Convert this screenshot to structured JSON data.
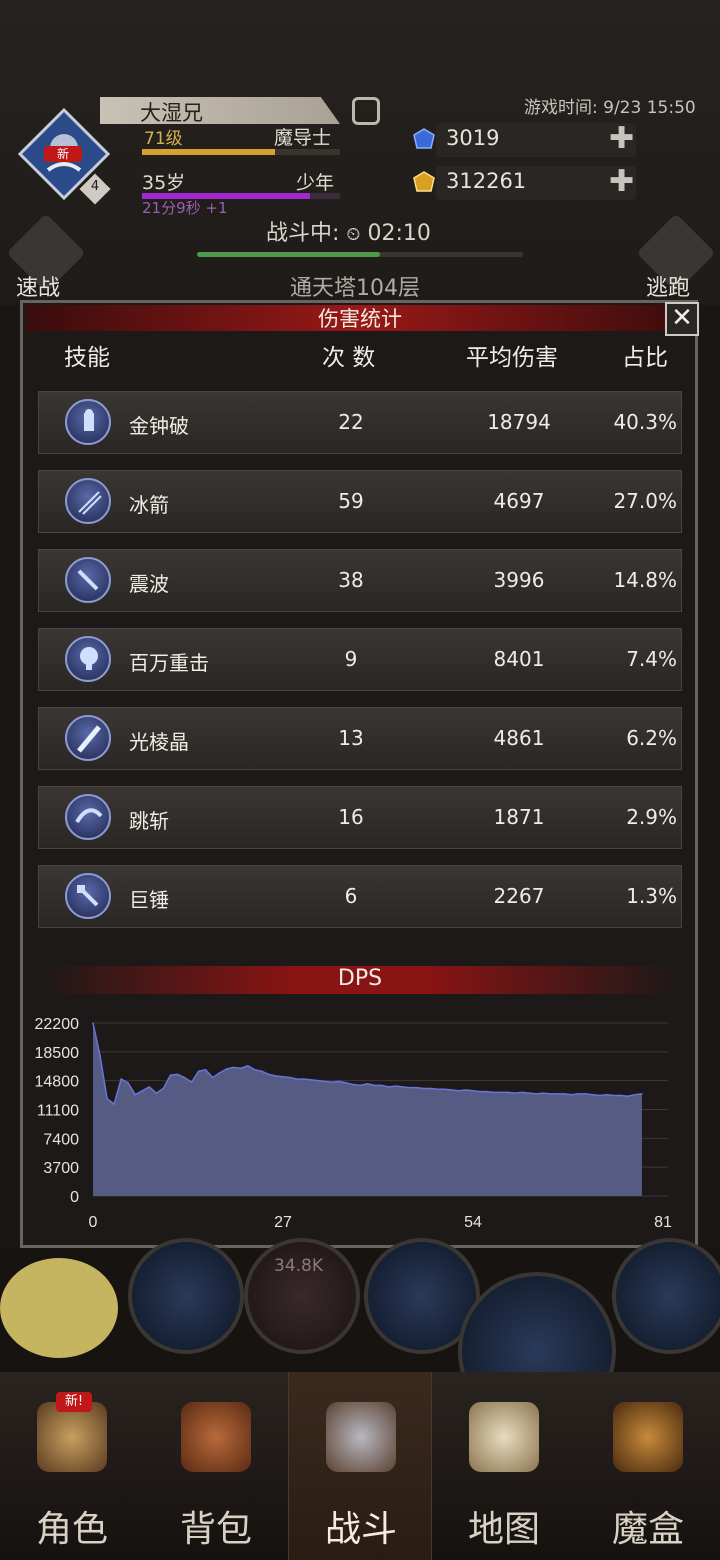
{
  "header": {
    "player_name": "大湿兄",
    "level": "71级",
    "class": "魔导士",
    "level_progress": 0.67,
    "age": "35岁",
    "age_stage": "少年",
    "age_progress": 0.85,
    "age_timer": "21分9秒 +1",
    "game_time": "游戏时间: 9/23 15:50",
    "emblem_badge": "新",
    "emblem_number": "4",
    "crystals": "3019",
    "gold": "312261",
    "battle_status": "战斗中:",
    "battle_time": "02:10",
    "battle_progress": 0.56,
    "tower_floor": "通天塔104层",
    "quick_battle_label": "速战",
    "escape_label": "逃跑"
  },
  "dialog": {
    "title": "伤害统计",
    "close_label": "✕",
    "columns": [
      "技能",
      "次 数",
      "平均伤害",
      "占比"
    ],
    "rows": [
      {
        "skill": "金钟破",
        "count": "22",
        "avg": "18794",
        "pct": "40.3%",
        "icon": "guardian-icon"
      },
      {
        "skill": "冰箭",
        "count": "59",
        "avg": "4697",
        "pct": "27.0%",
        "icon": "ice-arrow-icon"
      },
      {
        "skill": "震波",
        "count": "38",
        "avg": "3996",
        "pct": "14.8%",
        "icon": "sword-icon"
      },
      {
        "skill": "百万重击",
        "count": "9",
        "avg": "8401",
        "pct": "7.4%",
        "icon": "explosion-icon"
      },
      {
        "skill": "光棱晶",
        "count": "13",
        "avg": "4861",
        "pct": "6.2%",
        "icon": "light-blade-icon"
      },
      {
        "skill": "跳斩",
        "count": "16",
        "avg": "1871",
        "pct": "2.9%",
        "icon": "slash-icon"
      },
      {
        "skill": "巨锤",
        "count": "6",
        "avg": "2267",
        "pct": "1.3%",
        "icon": "hammer-icon"
      }
    ],
    "dps_title": "DPS"
  },
  "chart_data": {
    "type": "area",
    "title": "DPS",
    "xlabel": "",
    "ylabel": "",
    "xlim": [
      0,
      81
    ],
    "ylim": [
      0,
      22200
    ],
    "x_ticks": [
      "0",
      "27",
      "54",
      "81"
    ],
    "y_ticks": [
      "22200",
      "18500",
      "14800",
      "11100",
      "7400",
      "3700",
      "0"
    ],
    "grid": true,
    "color": "#5a5f8a",
    "line_color": "#6a74d8",
    "x": [
      0,
      1,
      2,
      3,
      4,
      5,
      6,
      7,
      8,
      9,
      10,
      11,
      12,
      13,
      14,
      15,
      16,
      17,
      18,
      19,
      20,
      21,
      22,
      23,
      24,
      25,
      26,
      27,
      28,
      29,
      30,
      31,
      32,
      33,
      34,
      35,
      36,
      37,
      38,
      39,
      40,
      41,
      42,
      43,
      44,
      45,
      46,
      47,
      48,
      49,
      50,
      51,
      52,
      53,
      54,
      55,
      56,
      57,
      58,
      59,
      60,
      61,
      62,
      63,
      64,
      65,
      66,
      67,
      68,
      69,
      70,
      71,
      72,
      73,
      74,
      75,
      76,
      77,
      78
    ],
    "values": [
      22200,
      18000,
      12500,
      11800,
      15000,
      14500,
      13000,
      13500,
      14000,
      13200,
      13800,
      15500,
      15600,
      15200,
      14600,
      16000,
      16200,
      15200,
      15800,
      16300,
      16500,
      16400,
      16700,
      16200,
      16000,
      15600,
      15400,
      15300,
      15200,
      15000,
      15000,
      14900,
      14800,
      14700,
      14600,
      14700,
      14500,
      14300,
      14200,
      14400,
      14200,
      14200,
      14000,
      14100,
      14000,
      13900,
      13900,
      13800,
      13800,
      13700,
      13700,
      13600,
      13500,
      13600,
      13500,
      13400,
      13400,
      13300,
      13300,
      13300,
      13200,
      13300,
      13200,
      13100,
      13200,
      13100,
      13100,
      13100,
      13000,
      13100,
      13100,
      13000,
      12900,
      13000,
      12900,
      12900,
      12800,
      13000,
      13100
    ]
  },
  "bottom_hud": {
    "damage_float": "34.8K"
  },
  "nav": {
    "items": [
      {
        "label": "角色",
        "icon": "helmet-icon",
        "badge": "新!"
      },
      {
        "label": "背包",
        "icon": "backpack-icon"
      },
      {
        "label": "战斗",
        "icon": "sword-shield-icon"
      },
      {
        "label": "地图",
        "icon": "scroll-map-icon"
      },
      {
        "label": "魔盒",
        "icon": "magic-box-icon"
      }
    ]
  }
}
